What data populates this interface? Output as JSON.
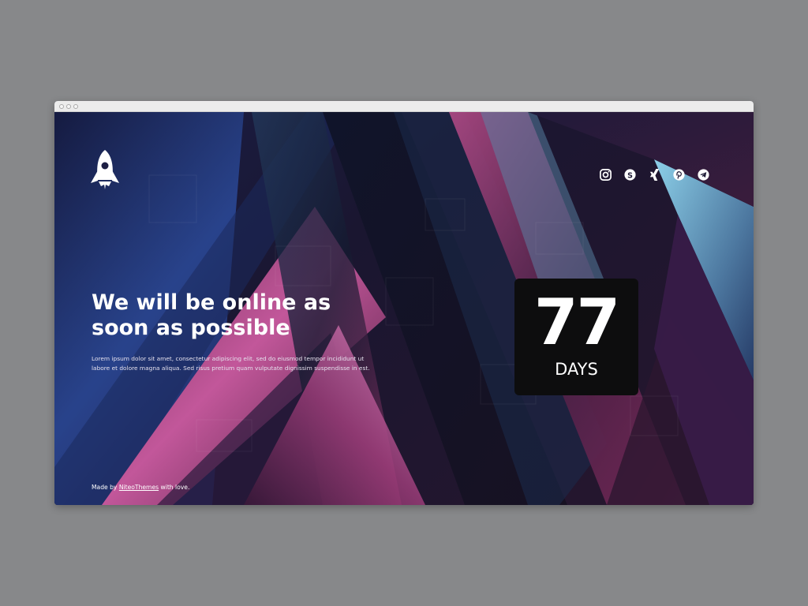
{
  "page": {
    "headline": "We will be online as soon as possible",
    "lede": "Lorem ipsum dolor sit amet, consectetur adipiscing elit, sed do eiusmod tempor incididunt ut labore et dolore magna aliqua. Sed risus pretium quam vulputate dignissim suspendisse in est.",
    "logo_icon": "rocket-icon"
  },
  "social": [
    {
      "icon": "instagram-icon"
    },
    {
      "icon": "skype-icon"
    },
    {
      "icon": "xing-icon"
    },
    {
      "icon": "pinterest-icon"
    },
    {
      "icon": "telegram-icon"
    }
  ],
  "countdown": {
    "value": "77",
    "unit": "DAYS"
  },
  "footer": {
    "prefix": "Made by ",
    "link": "NiteoThemes",
    "suffix": " with love."
  },
  "colors": {
    "page_bg": "#87888a",
    "counter_bg": "#0d0d0e",
    "accent_pink": "#c04a8a",
    "accent_blue": "#2c4f9e",
    "accent_cyan": "#6fb7d6"
  }
}
